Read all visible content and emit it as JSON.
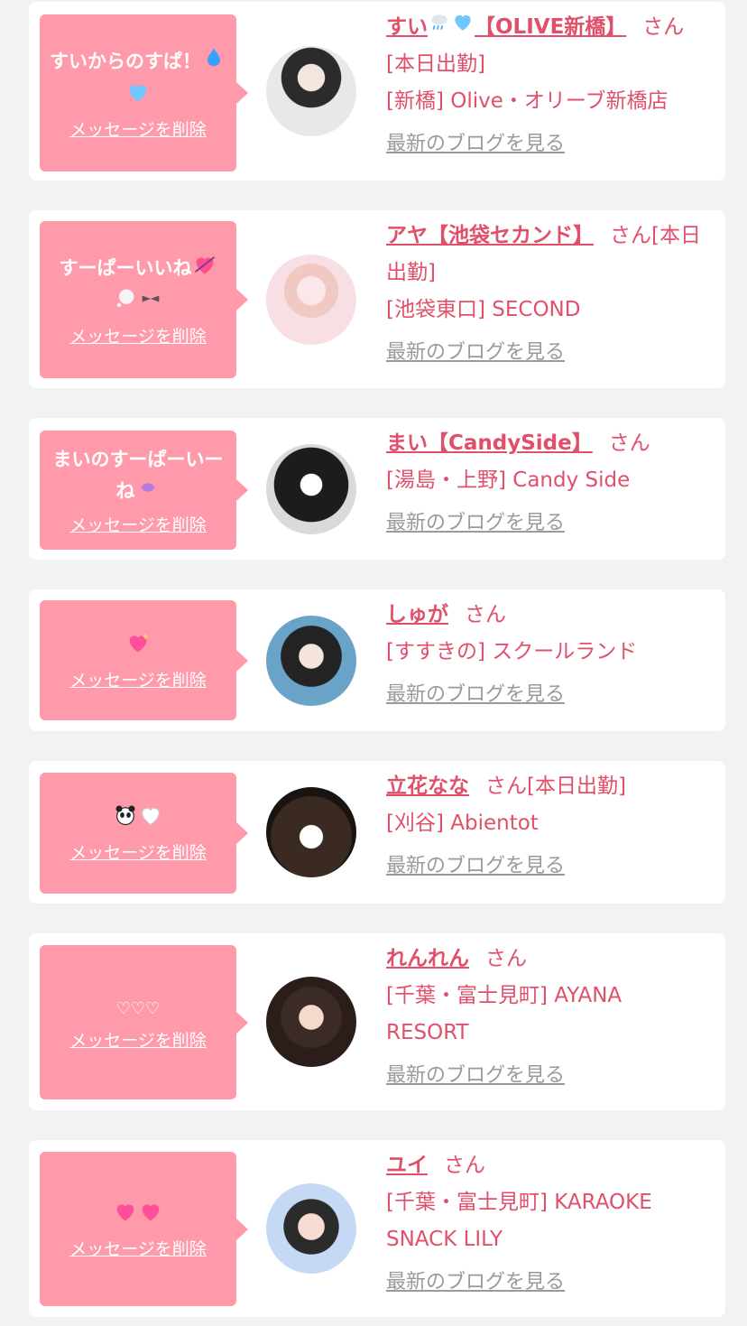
{
  "labels": {
    "delete_message": "メッセージを削除",
    "san": "さん",
    "blog_link": "最新のブログを見る"
  },
  "colors": {
    "bubble": "#ff9aaa",
    "accent": "#e0506a",
    "blog_link": "#9a9a9a",
    "card": "#ffffff",
    "background": "#f2f2f2"
  },
  "entries": [
    {
      "message": "すいからのすぱ！",
      "message_icons": [
        "droplet-icon",
        "blue-heart-icon"
      ],
      "name_prefix": "すい",
      "name_icons": [
        "rain-cloud-icon",
        "blue-heart-icon"
      ],
      "name_suffix": "【OLIVE新橋】",
      "status": "[本日出勤]",
      "shop": "[新橋] Olive・オリーブ新橋店"
    },
    {
      "message": "すーぱーいいね",
      "message_icons": [
        "heart-arrow-icon",
        "thought-bubble-icon",
        "ribbon-icon"
      ],
      "name_prefix": "アヤ【池袋セカンド】",
      "name_icons": [],
      "name_suffix": "",
      "status": "[本日出勤]",
      "shop": "[池袋東口] SECOND"
    },
    {
      "message": "まいのすーぱーいーね",
      "message_icons": [
        "candy-icon"
      ],
      "name_prefix": "まい【CandySide】",
      "name_icons": [],
      "name_suffix": "",
      "status": "",
      "shop": "[湯島・上野] Candy Side"
    },
    {
      "message": "",
      "message_icons": [
        "sparkling-heart-icon"
      ],
      "name_prefix": "しゅが",
      "name_icons": [],
      "name_suffix": "",
      "status": "",
      "shop": "[すすきの] スクールランド"
    },
    {
      "message": "",
      "message_icons": [
        "panda-icon",
        "white-heart-icon"
      ],
      "name_prefix": "立花なな",
      "name_icons": [],
      "name_suffix": "",
      "status": "[本日出勤]",
      "shop": "[刈谷] Abientot"
    },
    {
      "message": "♡♡♡",
      "message_icons": [],
      "name_prefix": "れんれん",
      "name_icons": [],
      "name_suffix": "",
      "status": "",
      "shop": "[千葉・富士見町] AYANA RESORT"
    },
    {
      "message": "",
      "message_icons": [
        "two-hearts-icon",
        "two-hearts-icon"
      ],
      "name_prefix": "ユイ",
      "name_icons": [],
      "name_suffix": "",
      "status": "",
      "shop": "[千葉・富士見町] KARAOKE SNACK LILY"
    }
  ]
}
